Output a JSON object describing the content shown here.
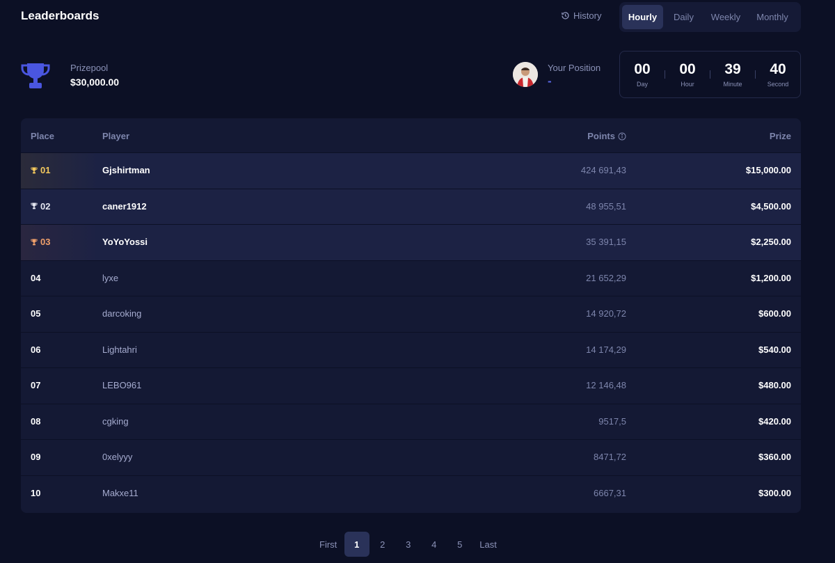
{
  "header": {
    "title": "Leaderboards",
    "history_label": "History",
    "tabs": [
      {
        "label": "Hourly",
        "active": true
      },
      {
        "label": "Daily",
        "active": false
      },
      {
        "label": "Weekly",
        "active": false
      },
      {
        "label": "Monthly",
        "active": false
      }
    ]
  },
  "prizepool": {
    "label": "Prizepool",
    "value": "$30,000.00"
  },
  "position": {
    "label": "Your Position",
    "value": "-"
  },
  "countdown": {
    "day": {
      "value": "00",
      "label": "Day"
    },
    "hour": {
      "value": "00",
      "label": "Hour"
    },
    "minute": {
      "value": "39",
      "label": "Minute"
    },
    "second": {
      "value": "40",
      "label": "Second"
    }
  },
  "table": {
    "headers": {
      "place": "Place",
      "player": "Player",
      "points": "Points",
      "prize": "Prize"
    },
    "rows": [
      {
        "place": "01",
        "player": "Gjshirtman",
        "points": "424 691,43",
        "prize": "$15,000.00"
      },
      {
        "place": "02",
        "player": "caner1912",
        "points": "48 955,51",
        "prize": "$4,500.00"
      },
      {
        "place": "03",
        "player": "YoYoYossi",
        "points": "35 391,15",
        "prize": "$2,250.00"
      },
      {
        "place": "04",
        "player": "lyxe",
        "points": "21 652,29",
        "prize": "$1,200.00"
      },
      {
        "place": "05",
        "player": "darcoking",
        "points": "14 920,72",
        "prize": "$600.00"
      },
      {
        "place": "06",
        "player": "Lightahri",
        "points": "14 174,29",
        "prize": "$540.00"
      },
      {
        "place": "07",
        "player": "LEBO961",
        "points": "12 146,48",
        "prize": "$480.00"
      },
      {
        "place": "08",
        "player": "cgking",
        "points": "9517,5",
        "prize": "$420.00"
      },
      {
        "place": "09",
        "player": "0xelyyy",
        "points": "8471,72",
        "prize": "$360.00"
      },
      {
        "place": "10",
        "player": "Makxe11",
        "points": "6667,31",
        "prize": "$300.00"
      }
    ]
  },
  "pagination": {
    "first": "First",
    "pages": [
      "1",
      "2",
      "3",
      "4",
      "5"
    ],
    "current": "1",
    "last": "Last"
  },
  "colors": {
    "background": "#0c1025",
    "panel": "#141934",
    "accent": "#5a68e8",
    "gold": "#f4c95d",
    "silver": "#e4e6f0",
    "bronze": "#f0a06b"
  },
  "icons": {
    "history": "clock-history-icon",
    "prizepool": "trophy-icon",
    "points_info": "info-icon",
    "rank_top3": "trophy-icon"
  }
}
